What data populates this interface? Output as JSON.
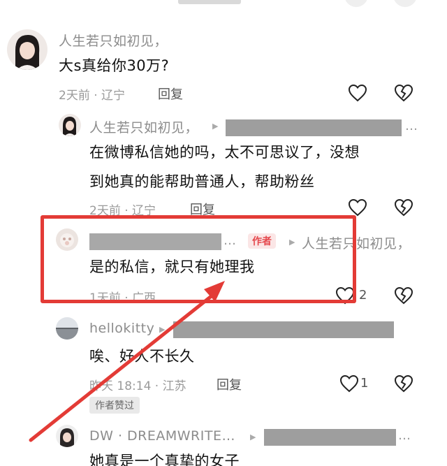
{
  "comments": [
    {
      "nickname": "人生若只如初见，",
      "text": "大s真给你30万?",
      "time_location": "2天前 · 辽宁",
      "reply_label": "回复"
    },
    {
      "nickname": "人生若只如初见，",
      "ellipsis": "…",
      "text_line1": "在微博私信她的吗，太不可思议了，没想",
      "text_line2": "到她真的能帮助普通人，帮助粉丝",
      "time_location": "2天前 · 辽宁",
      "reply_label": "回复"
    },
    {
      "ellipsis": "…",
      "author_badge": "作者",
      "reply_to": "人生若只如初见，",
      "text": "是的私信，就只有她理我",
      "time_location": "1天前 · 广西",
      "like_count": "2"
    },
    {
      "nickname": "hellokitty",
      "text": "唉、好人不长久",
      "time_location": "昨天 18:14 · 江苏",
      "reply_label": "回复",
      "like_count": "1",
      "badge": "作者赞过"
    },
    {
      "nickname": "DW · DREAMWRITE…",
      "ellipsis": "…",
      "text": "她真是一个真挚的女子"
    }
  ],
  "colors": {
    "highlight": "#e33b36",
    "author_badge": "#e5484d"
  },
  "icons": [
    "heart-icon",
    "broken-heart-icon",
    "reply-arrow-icon"
  ]
}
